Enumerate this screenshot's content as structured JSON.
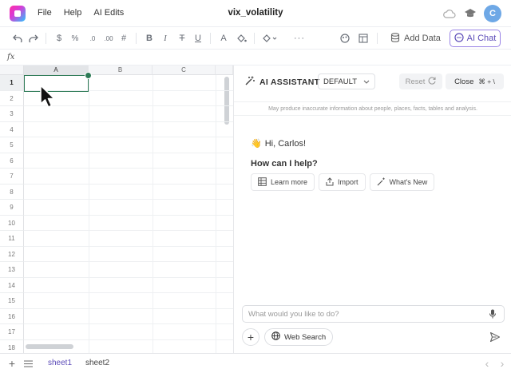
{
  "app": {
    "document_title": "vix_volatility",
    "menu": [
      "File",
      "Help",
      "AI Edits"
    ],
    "user_initial": "C"
  },
  "toolbar": {
    "currency_symbol": "$",
    "percent_symbol": "%",
    "decrease_decimals": ".0",
    "increase_decimals": ".00",
    "number_format_symbol": "#",
    "bold": "B",
    "italic": "I",
    "strikethrough": "T",
    "underline": "U",
    "font_color": "A",
    "more": "···",
    "add_data_label": "Add Data",
    "ai_chat_label": "AI Chat"
  },
  "formula_bar": {
    "fx_label": "fx"
  },
  "grid": {
    "columns": [
      "A",
      "B",
      "C"
    ],
    "rows": [
      "1",
      "2",
      "3",
      "4",
      "5",
      "6",
      "7",
      "8",
      "9",
      "10",
      "11",
      "12",
      "13",
      "14",
      "15",
      "16",
      "17",
      "18"
    ],
    "selected_cell": "A1"
  },
  "sheets": {
    "tabs": [
      "sheet1",
      "sheet2"
    ],
    "active": "sheet1"
  },
  "ai_panel": {
    "title": "AI ASSISTANT",
    "mode": "DEFAULT",
    "reset_label": "Reset",
    "close_label": "Close",
    "close_shortcut": "⌘ + \\",
    "disclaimer": "May produce inaccurate information about people, places, facts, tables and analysis.",
    "greeting_emoji": "👋",
    "greeting": "Hi, Carlos!",
    "help_prompt": "How can I help?",
    "chips": [
      "Learn more",
      "Import",
      "What's New"
    ],
    "input_placeholder": "What would you like to do?",
    "web_search_label": "Web Search",
    "plus_label": "+"
  },
  "colors": {
    "accent": "#5b4bb8",
    "selection": "#2d7a56"
  }
}
